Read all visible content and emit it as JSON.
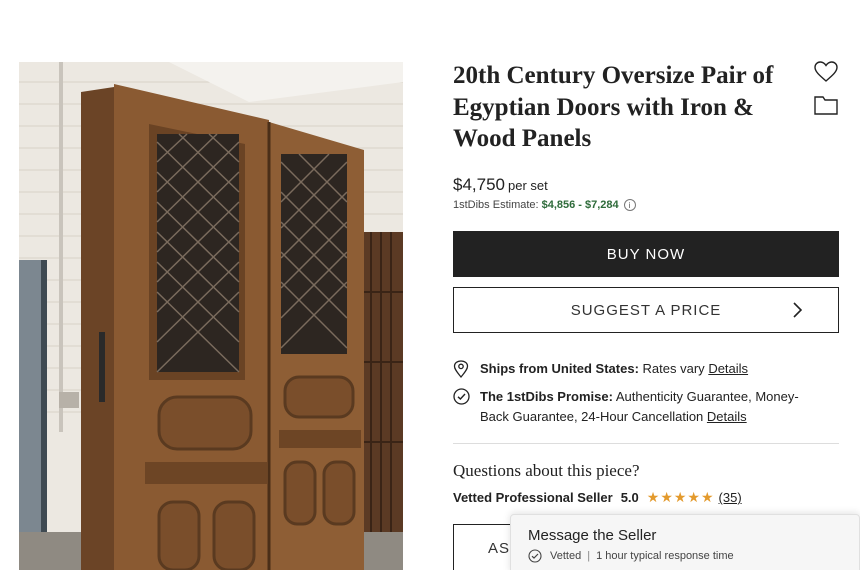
{
  "product": {
    "title": "20th Century Oversize Pair of Egyptian Doors with Iron & Wood Panels",
    "image_alt": "Pair of tall carved wooden doors with wrought iron grille windows leaning against a brick wall",
    "price": "$4,750",
    "price_unit": "per set",
    "estimate_label": "1stDibs Estimate:",
    "estimate_range": "$4,856 - $7,284",
    "info_icon": "info-icon"
  },
  "actions": {
    "favorite_icon": "heart-icon",
    "save_icon": "folder-icon",
    "buy_label": "BUY NOW",
    "suggest_label": "SUGGEST A PRICE",
    "suggest_icon": "chevron-right-icon"
  },
  "shipping": {
    "icon": "location-pin-icon",
    "label": "Ships from United States:",
    "text": "Rates vary",
    "link": "Details"
  },
  "promise": {
    "icon": "check-circle-icon",
    "label": "The 1stDibs Promise:",
    "text": "Authenticity Guarantee, Money-Back Guarantee, 24-Hour Cancellation",
    "link": "Details"
  },
  "seller": {
    "questions": "Questions about this piece?",
    "label": "Vetted Professional Seller",
    "rating": "5.0",
    "stars": "★★★★★",
    "reviews": "(35)",
    "ask_label": "AS"
  },
  "message_widget": {
    "title": "Message the Seller",
    "vetted": "Vetted",
    "separator": "|",
    "response": "1 hour typical response time",
    "icon": "check-circle-icon"
  },
  "colors": {
    "primary_button": "#222222",
    "estimate_green": "#2e6b3a",
    "star": "#e39a2d"
  }
}
